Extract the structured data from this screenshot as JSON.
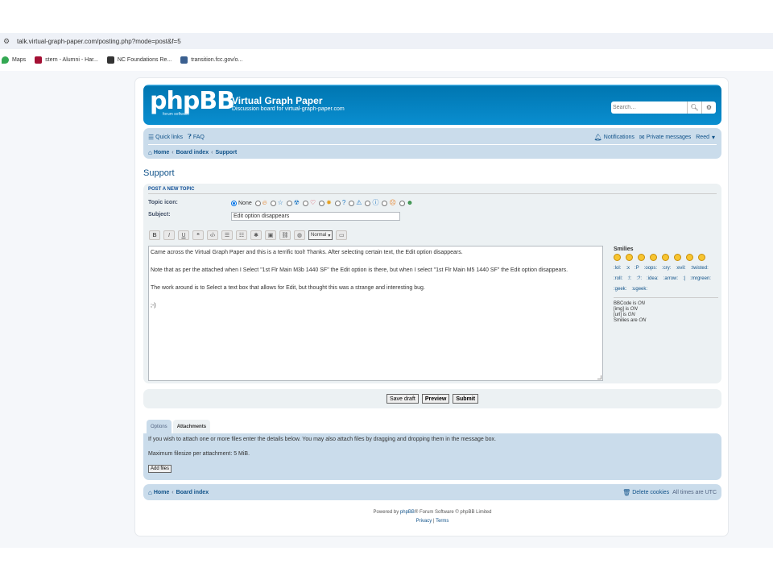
{
  "browser": {
    "url": "talk.virtual-graph-paper.com/posting.php?mode=post&f=5",
    "bookmarks": [
      {
        "label": "Maps",
        "icon": "map-pin-icon",
        "color": "#34a853"
      },
      {
        "label": "stern - Alumni - Har...",
        "icon": "harvard-shield-icon",
        "color": "#a41034"
      },
      {
        "label": "NC Foundations Re...",
        "icon": "nc-square-icon",
        "color": "#333333"
      },
      {
        "label": "transition.fcc.gov/o...",
        "icon": "fcc-icon",
        "color": "#3a5f8f"
      }
    ]
  },
  "header": {
    "logo_text": "phpBB",
    "logo_sub": "forum software",
    "site_title": "Virtual Graph Paper",
    "site_desc": "Discussion board for virtual-graph-paper.com",
    "search_placeholder": "Search…"
  },
  "navbar": {
    "quick_links": "Quick links",
    "faq": "FAQ",
    "notifications": "Notifications",
    "private_messages": "Private messages",
    "user": "Reed",
    "breadcrumbs": [
      "Home",
      "Board index",
      "Support"
    ]
  },
  "page": {
    "title": "Support",
    "panel_heading": "Post a new topic",
    "topic_icon_label": "Topic icon:",
    "topic_icon_none": "None",
    "subject_label": "Subject:",
    "subject_value": "Edit option disappears",
    "font_size_select": "Normal",
    "message": "Came across the Virtual Graph Paper and this is a terrific tool! Thanks. After selecting certain text, the Edit option disappears.\n\nNote that as per the attached when I Select \"1st Flr Main M3b 1440 SF\" the Edit option is there, but when I select \"1st Flr Main M5 1440 SF\" the Edit option disappears.\n\nThe work around is to Select a text box that allows for Edit, but thought this was a strange and interesting bug.\n\n;-)"
  },
  "smilies": {
    "title": "Smilies",
    "codes": [
      ":lol:",
      ":x",
      ":P",
      ":oops:",
      ":cry:",
      ":evil:",
      ":twisted:",
      ":roll:",
      ":!:",
      ":?:",
      ":idea:",
      ":arrow:",
      ":|",
      ":mrgreen:",
      ":geek:",
      ":ugeek:"
    ],
    "bbcode_status": {
      "prefix": "BBCode is ",
      "value": "ON"
    },
    "img_status": {
      "prefix": "[img] is ",
      "value": "ON"
    },
    "url_status": {
      "prefix": "[url] is ",
      "value": "ON"
    },
    "smilies_status": {
      "prefix": "Smilies are ",
      "value": "ON"
    }
  },
  "buttons": {
    "save_draft": "Save draft",
    "preview": "Preview",
    "submit": "Submit",
    "add_files": "Add files"
  },
  "tabs": {
    "options": "Options",
    "attachments": "Attachments"
  },
  "attachments": {
    "info": "If you wish to attach one or more files enter the details below. You may also attach files by dragging and dropping them in the message box.",
    "max_size": "Maximum filesize per attachment: 5 MiB."
  },
  "footer": {
    "home": "Home",
    "board_index": "Board index",
    "delete_cookies": "Delete cookies",
    "timezone": "All times are UTC",
    "powered_prefix": "Powered by ",
    "powered_link": "phpBB",
    "powered_suffix": "® Forum Software © phpBB Limited",
    "privacy": "Privacy",
    "terms": "Terms"
  },
  "colors": {
    "header_blue": "#12a3eb",
    "nav_bg": "#cadceb",
    "panel_bg": "#ecf1f3",
    "link": "#105289"
  }
}
